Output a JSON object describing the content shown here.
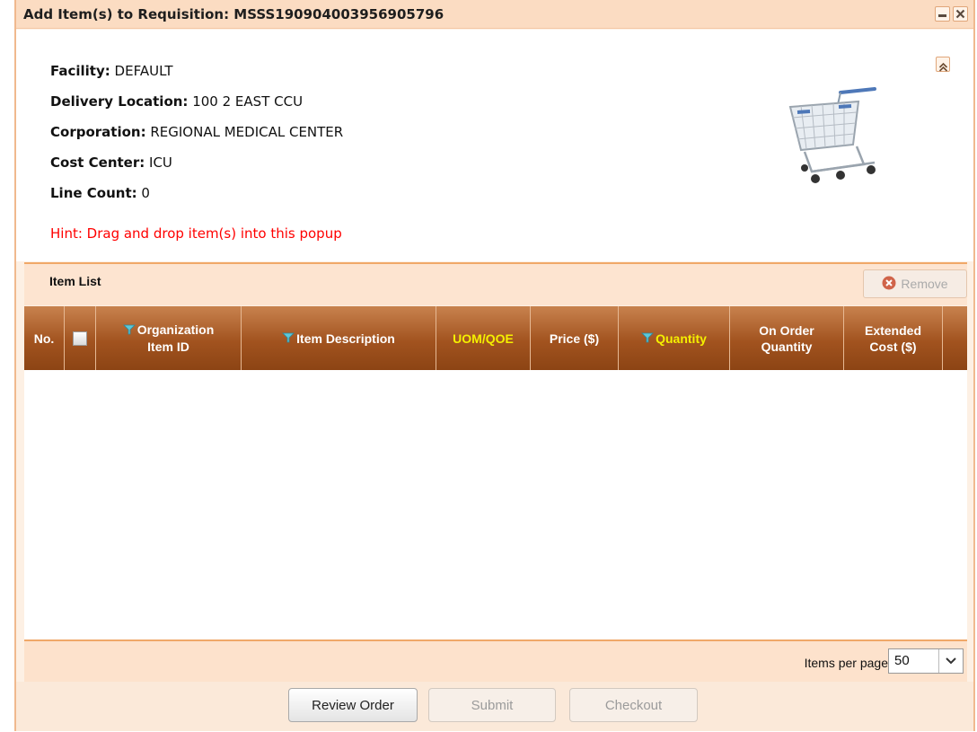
{
  "popup": {
    "title": "Add Item(s) to Requisition: MSSS190904003956905796"
  },
  "info": {
    "facility_label": "Facility:",
    "facility_value": "DEFAULT",
    "delivery_label": "Delivery Location:",
    "delivery_value": "100 2 EAST CCU",
    "corporation_label": "Corporation:",
    "corporation_value": "REGIONAL MEDICAL CENTER",
    "cost_center_label": "Cost Center:",
    "cost_center_value": "ICU",
    "line_count_label": "Line Count:",
    "line_count_value": "0",
    "hint": "Hint: Drag and drop item(s) into this popup"
  },
  "item_list": {
    "title": "Item List",
    "remove_label": "Remove"
  },
  "grid": {
    "columns": {
      "no": "No.",
      "org_item_id_1": "Organization",
      "org_item_id_2": "Item ID",
      "item_description": "Item Description",
      "uom": "UOM/QOE",
      "price": "Price ($)",
      "quantity": "Quantity",
      "on_order_1": "On Order",
      "on_order_2": "Quantity",
      "extended_1": "Extended",
      "extended_2": "Cost ($)"
    },
    "rows": []
  },
  "pager": {
    "items_per_page_label": "Items per page",
    "items_per_page_value": "50"
  },
  "footer": {
    "review_label": "Review Order",
    "submit_label": "Submit",
    "checkout_label": "Checkout"
  },
  "colors": {
    "header_brown": "#a2531f",
    "accent_orange": "#f0a868",
    "hint_red": "#ff0000",
    "highlight_yellow": "#f5f000"
  },
  "icons": {
    "minimize": "minimize-icon",
    "close": "close-icon",
    "collapse": "collapse-up-icon",
    "cart": "shopping-cart-icon",
    "remove": "remove-x-icon",
    "filter": "filter-icon",
    "dropdown": "chevron-down-icon"
  }
}
